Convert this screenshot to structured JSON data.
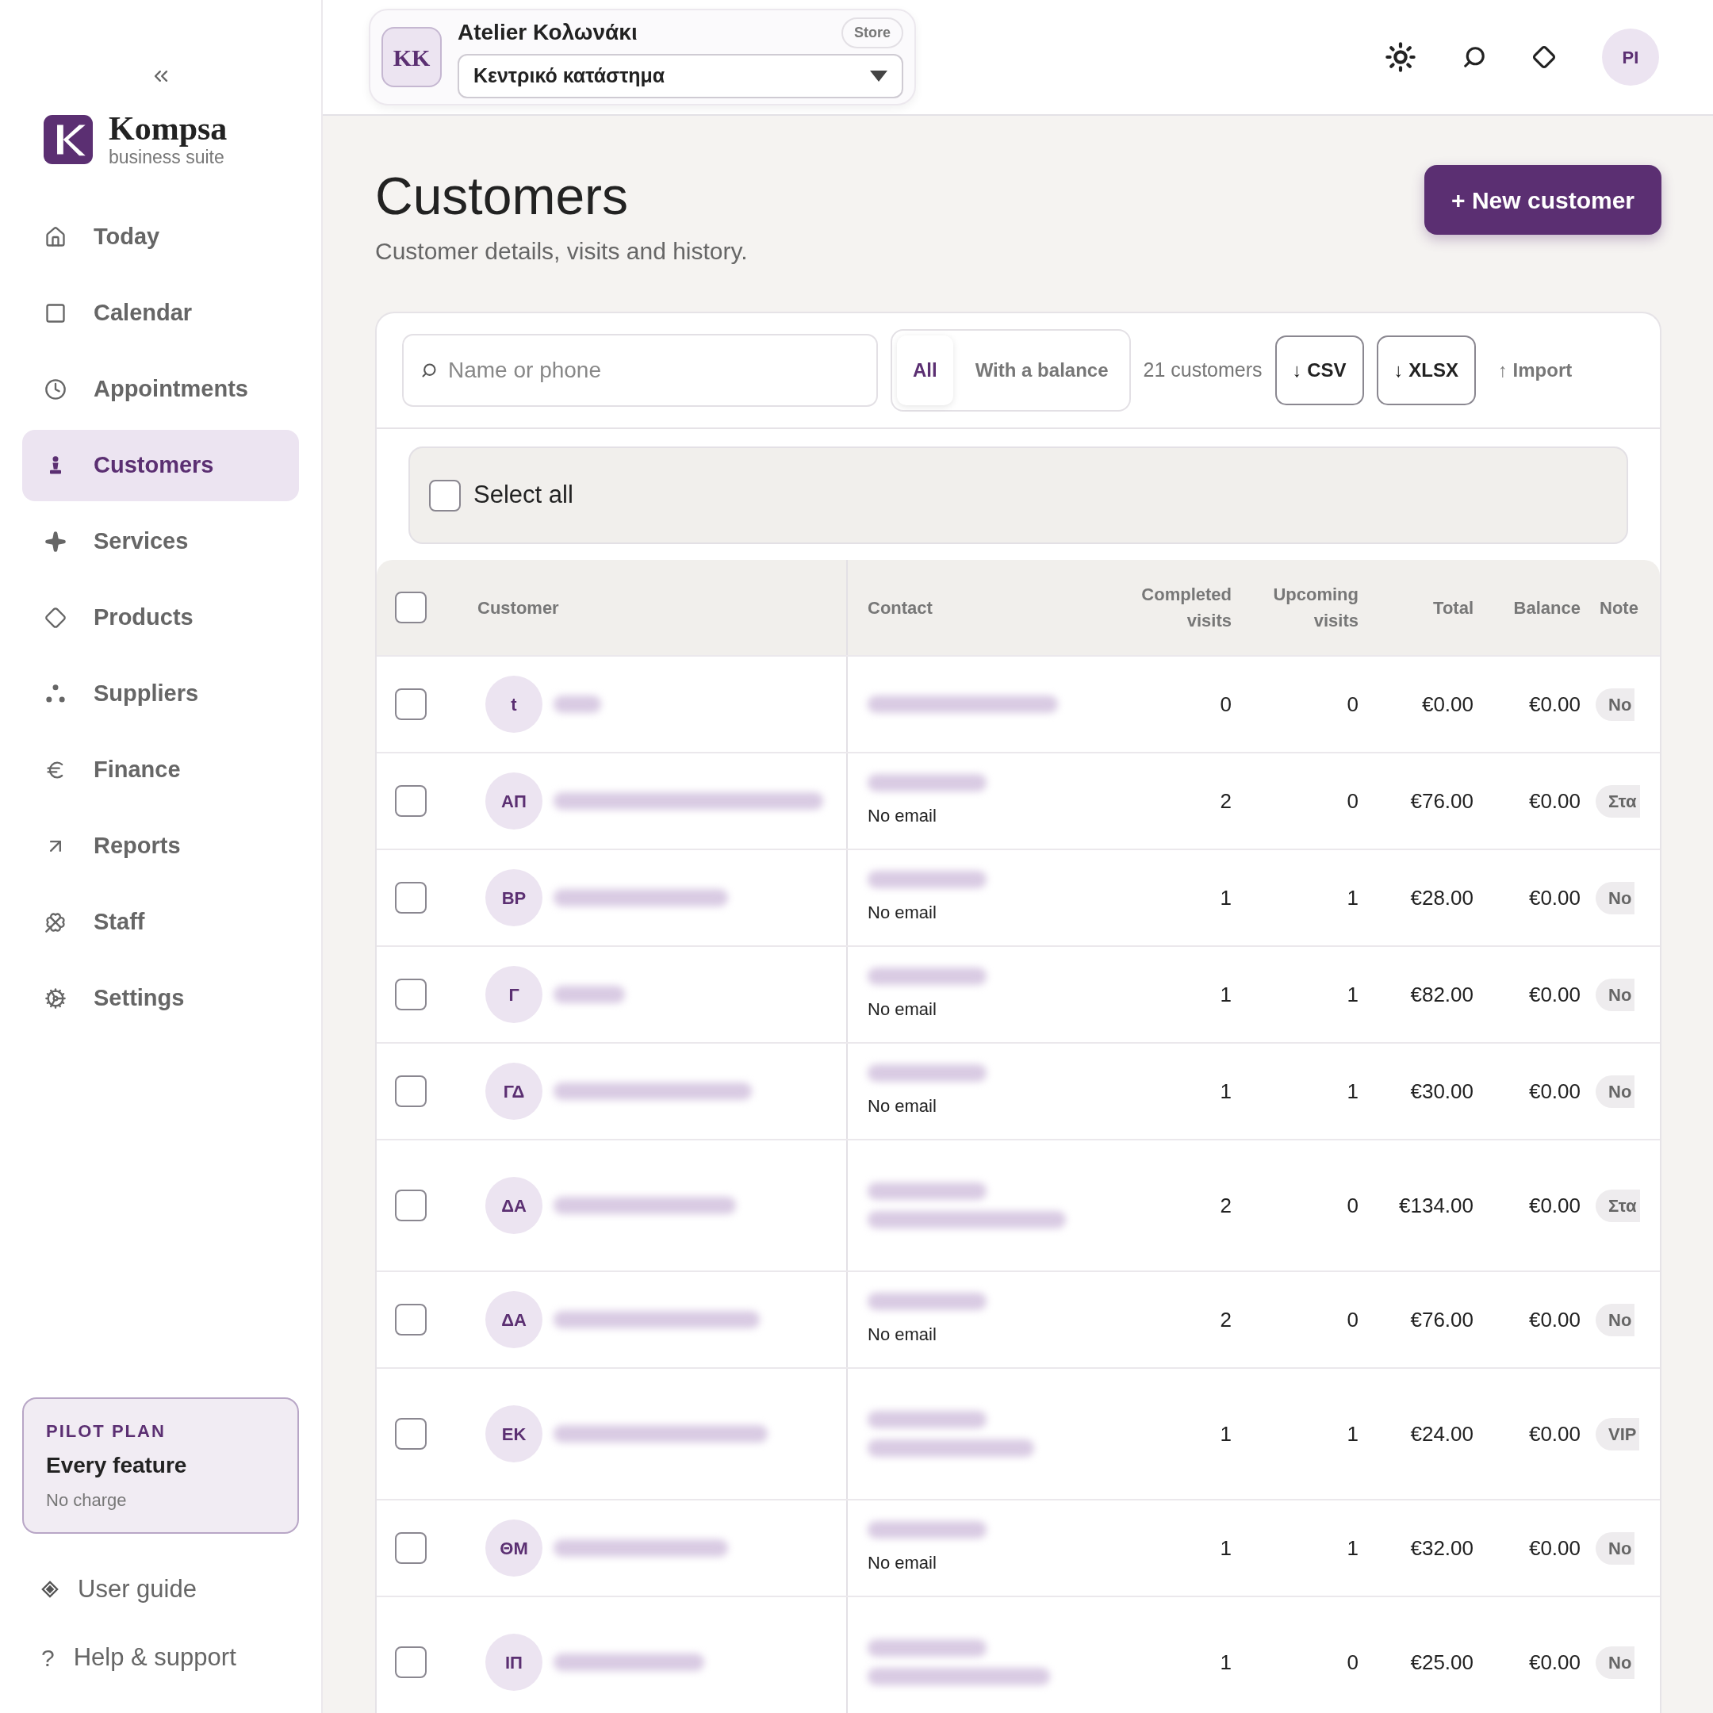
{
  "sidebar": {
    "brand": {
      "name": "Kompsa",
      "tagline": "business suite"
    },
    "nav": [
      {
        "label": "Today",
        "selected": false
      },
      {
        "label": "Calendar",
        "selected": false
      },
      {
        "label": "Appointments",
        "selected": false
      },
      {
        "label": "Customers",
        "selected": true
      },
      {
        "label": "Services",
        "selected": false
      },
      {
        "label": "Products",
        "selected": false
      },
      {
        "label": "Suppliers",
        "selected": false
      },
      {
        "label": "Finance",
        "selected": false
      },
      {
        "label": "Reports",
        "selected": false
      },
      {
        "label": "Staff",
        "selected": false
      },
      {
        "label": "Settings",
        "selected": false
      }
    ],
    "plan": {
      "eyebrow": "PILOT PLAN",
      "title": "Every feature",
      "note": "No charge"
    },
    "footer_links": [
      {
        "label": "User guide"
      },
      {
        "label": "Help & support",
        "glyph": "?"
      }
    ]
  },
  "header": {
    "store_initials": "KK",
    "store_name": "Atelier Κολωνάκι",
    "store_badge": "Store",
    "location": "Κεντρικό κατάστημα",
    "avatar": "PI"
  },
  "page": {
    "title": "Customers",
    "subtitle": "Customer details, visits and history.",
    "new_button": "+ New customer"
  },
  "toolbar": {
    "search_placeholder": "Name or phone",
    "filters": [
      {
        "label": "All",
        "selected": true
      },
      {
        "label": "With a balance",
        "selected": false
      }
    ],
    "count": "21 customers",
    "buttons": [
      "↓ CSV",
      "↓ XLSX"
    ],
    "import": "↑ Import"
  },
  "select_all": {
    "label": "Select all",
    "checked": false
  },
  "table": {
    "header_checked": false,
    "columns": [
      "Customer",
      "Contact",
      "Completed visits",
      "Upcoming visits",
      "Total",
      "Balance",
      "Note"
    ],
    "rows": [
      {
        "checked": false,
        "initials": "t",
        "contact": [
          {
            "kind": "blurred"
          }
        ],
        "completed": "0",
        "upcoming": "0",
        "total": "€0.00",
        "balance": "€0.00",
        "note": "No"
      },
      {
        "checked": false,
        "initials": "ΑΠ",
        "contact": [
          {
            "kind": "blurred"
          },
          {
            "kind": "text",
            "text": "No email"
          }
        ],
        "completed": "2",
        "upcoming": "0",
        "total": "€76.00",
        "balance": "€0.00",
        "note": "Στα"
      },
      {
        "checked": false,
        "initials": "ΒΡ",
        "contact": [
          {
            "kind": "blurred"
          },
          {
            "kind": "text",
            "text": "No email"
          }
        ],
        "completed": "1",
        "upcoming": "1",
        "total": "€28.00",
        "balance": "€0.00",
        "note": "No"
      },
      {
        "checked": false,
        "initials": "Γ",
        "contact": [
          {
            "kind": "blurred"
          },
          {
            "kind": "text",
            "text": "No email"
          }
        ],
        "completed": "1",
        "upcoming": "1",
        "total": "€82.00",
        "balance": "€0.00",
        "note": "No"
      },
      {
        "checked": false,
        "initials": "ΓΔ",
        "contact": [
          {
            "kind": "blurred"
          },
          {
            "kind": "text",
            "text": "No email"
          }
        ],
        "completed": "1",
        "upcoming": "1",
        "total": "€30.00",
        "balance": "€0.00",
        "note": "No"
      },
      {
        "checked": false,
        "initials": "ΔΑ",
        "contact": [
          {
            "kind": "blurred"
          },
          {
            "kind": "blurred"
          }
        ],
        "completed": "2",
        "upcoming": "0",
        "total": "€134.00",
        "balance": "€0.00",
        "note": "Στα"
      },
      {
        "checked": false,
        "initials": "ΔΑ",
        "contact": [
          {
            "kind": "blurred"
          },
          {
            "kind": "text",
            "text": "No email"
          }
        ],
        "completed": "2",
        "upcoming": "0",
        "total": "€76.00",
        "balance": "€0.00",
        "note": "No"
      },
      {
        "checked": false,
        "initials": "ΕΚ",
        "contact": [
          {
            "kind": "blurred"
          },
          {
            "kind": "blurred"
          }
        ],
        "completed": "1",
        "upcoming": "1",
        "total": "€24.00",
        "balance": "€0.00",
        "note": "VIP"
      },
      {
        "checked": false,
        "initials": "ΘΜ",
        "contact": [
          {
            "kind": "blurred"
          },
          {
            "kind": "text",
            "text": "No email"
          }
        ],
        "completed": "1",
        "upcoming": "1",
        "total": "€32.00",
        "balance": "€0.00",
        "note": "No"
      },
      {
        "checked": false,
        "initials": "ΙΠ",
        "contact": [
          {
            "kind": "blurred"
          },
          {
            "kind": "blurred"
          }
        ],
        "completed": "1",
        "upcoming": "0",
        "total": "€25.00",
        "balance": "€0.00",
        "note": "No"
      }
    ]
  }
}
